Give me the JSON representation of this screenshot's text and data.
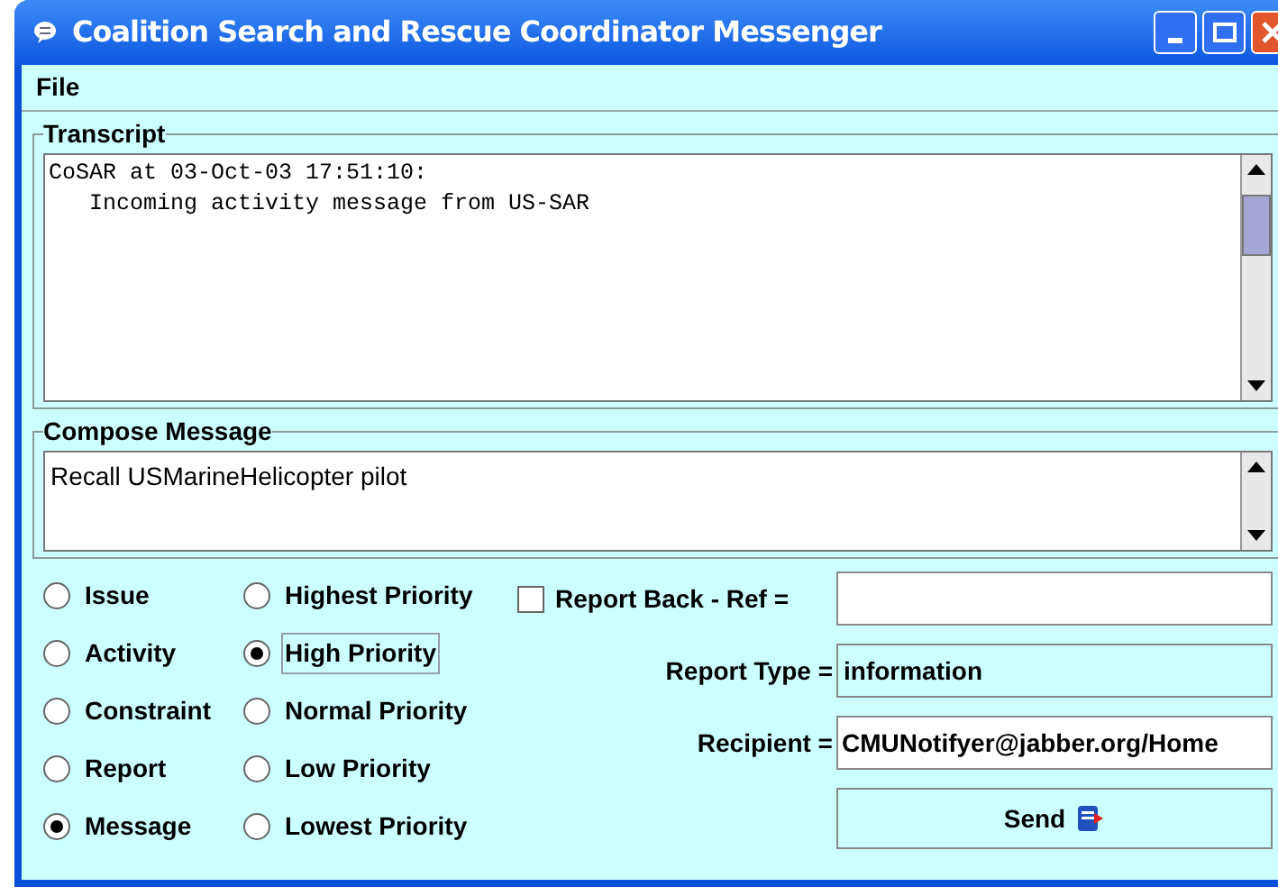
{
  "window": {
    "title": "Coalition Search and Rescue Coordinator Messenger"
  },
  "menu": [
    "File"
  ],
  "transcript": {
    "label": "Transcript",
    "lines": [
      "CoSAR at 03-Oct-03 17:51:10:",
      "   Incoming activity message from US-SAR"
    ]
  },
  "compose": {
    "label": "Compose Message",
    "text": "Recall USMarineHelicopter pilot"
  },
  "message_types": [
    {
      "label": "Issue",
      "selected": false
    },
    {
      "label": "Activity",
      "selected": false
    },
    {
      "label": "Constraint",
      "selected": false
    },
    {
      "label": "Report",
      "selected": false
    },
    {
      "label": "Message",
      "selected": true
    }
  ],
  "priorities": [
    {
      "label": "Highest Priority",
      "selected": false
    },
    {
      "label": "High Priority",
      "selected": true
    },
    {
      "label": "Normal Priority",
      "selected": false
    },
    {
      "label": "Low Priority",
      "selected": false
    },
    {
      "label": "Lowest Priority",
      "selected": false
    }
  ],
  "report_back": {
    "label": "Report Back - Ref =",
    "checked": false
  },
  "report_type": {
    "label": "Report Type =",
    "value": "information"
  },
  "recipient": {
    "label": "Recipient =",
    "value": "CMUNotifyer@jabber.org/Home"
  },
  "send_button": {
    "label": "Send"
  }
}
